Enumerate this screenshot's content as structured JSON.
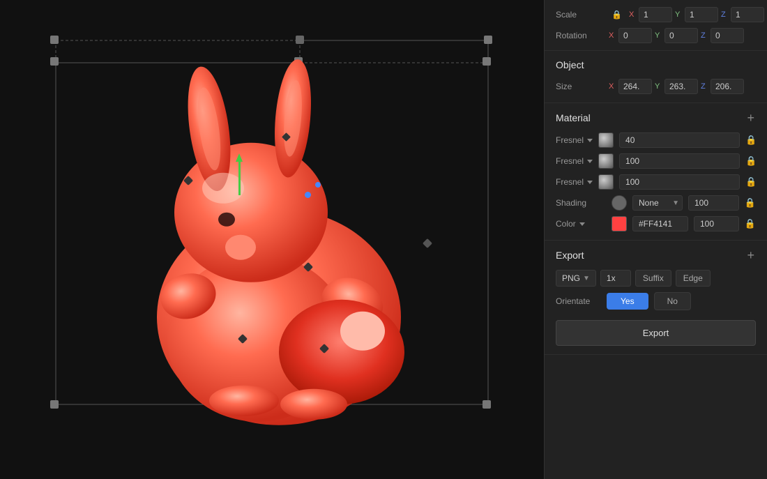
{
  "viewport": {
    "bg_color": "#111111"
  },
  "panel": {
    "transform": {
      "scale_label": "Scale",
      "scale_x": "1",
      "scale_y": "1",
      "scale_z": "1",
      "rotation_label": "Rotation",
      "rotation_x": "0",
      "rotation_y": "0",
      "rotation_z": "0"
    },
    "object": {
      "title": "Object",
      "size_label": "Size",
      "size_x": "264.",
      "size_y": "263.",
      "size_z": "206."
    },
    "material": {
      "title": "Material",
      "add_label": "+",
      "fresnel1_label": "Fresnel",
      "fresnel1_value": "40",
      "fresnel2_label": "Fresnel",
      "fresnel2_value": "100",
      "fresnel3_label": "Fresnel",
      "fresnel3_value": "100",
      "shading_label": "Shading",
      "shading_value": "None",
      "shading_amount": "100",
      "color_label": "Color",
      "color_hex": "#FF4141",
      "color_amount": "100"
    },
    "export": {
      "title": "Export",
      "add_label": "+",
      "format": "PNG",
      "scale": "1x",
      "suffix_label": "Suffix",
      "edge_label": "Edge",
      "orientate_label": "Orientate",
      "yes_label": "Yes",
      "no_label": "No",
      "export_label": "Export"
    }
  }
}
